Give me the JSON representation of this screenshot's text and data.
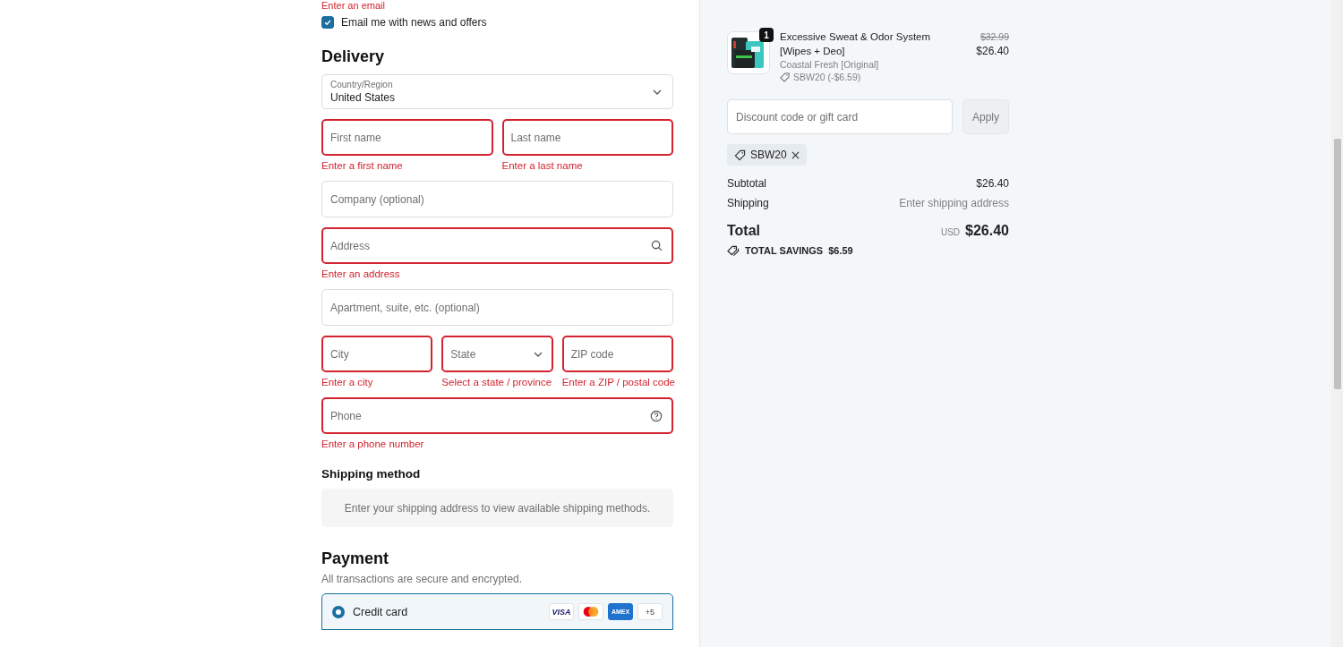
{
  "email_error": "Enter an email",
  "newsletter": {
    "label": "Email me with news and offers",
    "checked": true
  },
  "delivery": {
    "heading": "Delivery",
    "country": {
      "label": "Country/Region",
      "value": "United States"
    },
    "rows": [
      [
        {
          "placeholder": "First name",
          "kind": "text",
          "invalid": true,
          "error": "Enter a first name"
        },
        {
          "placeholder": "Last name",
          "kind": "text",
          "invalid": true,
          "error": "Enter a last name"
        }
      ],
      [
        {
          "placeholder": "Company (optional)",
          "kind": "text",
          "invalid": false
        }
      ],
      [
        {
          "placeholder": "Address",
          "kind": "search",
          "invalid": true,
          "error": "Enter an address"
        }
      ],
      [
        {
          "placeholder": "Apartment, suite, etc. (optional)",
          "kind": "text",
          "invalid": false
        }
      ],
      [
        {
          "placeholder": "City",
          "kind": "text",
          "invalid": true,
          "error": "Enter a city"
        },
        {
          "placeholder": "State",
          "kind": "select",
          "invalid": true,
          "error": "Select a state / province"
        },
        {
          "placeholder": "ZIP code",
          "kind": "text",
          "invalid": true,
          "error": "Enter a ZIP / postal code"
        }
      ],
      [
        {
          "placeholder": "Phone",
          "kind": "help",
          "invalid": true,
          "error": "Enter a phone number"
        }
      ]
    ]
  },
  "shipping": {
    "heading": "Shipping method",
    "notice": "Enter your shipping address to view available shipping methods."
  },
  "payment": {
    "heading": "Payment",
    "subtitle": "All transactions are secure and encrypted.",
    "options": [
      {
        "label": "Credit card",
        "selected": true,
        "cards": [
          {
            "kind": "visa",
            "text": "VISA"
          },
          {
            "kind": "mastercard"
          },
          {
            "kind": "amex",
            "text": "AMEX"
          },
          {
            "kind": "more",
            "text": "+5"
          }
        ]
      }
    ]
  },
  "summary": {
    "item": {
      "quantity": "1",
      "name": "Excessive Sweat & Odor System [Wipes + Deo]",
      "variant": "Coastal Fresh [Original]",
      "discount": "SBW20 (-$6.59)",
      "old_price": "$32.99",
      "price": "$26.40"
    },
    "discount_field": {
      "placeholder": "Discount code or gift card"
    },
    "apply": {
      "label": "Apply",
      "disabled": true
    },
    "codes": [
      "SBW20"
    ],
    "lines": [
      {
        "label": "Subtotal",
        "value": "$26.40",
        "muted": false
      },
      {
        "label": "Shipping",
        "value": "Enter shipping address",
        "muted": true
      }
    ],
    "total": {
      "label": "Total",
      "currency": "USD",
      "value": "$26.40"
    },
    "savings": {
      "label": "TOTAL SAVINGS",
      "value": "$6.59"
    }
  }
}
